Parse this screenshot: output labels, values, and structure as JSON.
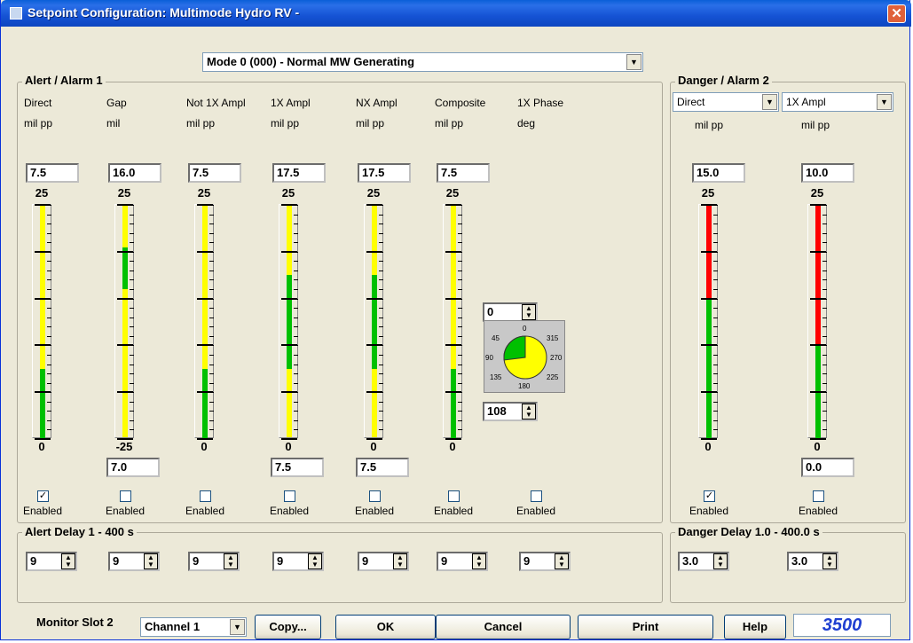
{
  "window": {
    "title": "Setpoint Configuration:  Multimode Hydro RV -",
    "close": "✕"
  },
  "mode_select": {
    "value": "Mode 0 (000) - Normal MW Generating"
  },
  "alert_group": {
    "label": "Alert / Alarm 1"
  },
  "danger_group": {
    "label": "Danger / Alarm 2",
    "combo1": "Direct",
    "combo2": "1X Ampl",
    "unit1": "mil pp",
    "unit2": "mil pp"
  },
  "columns": [
    {
      "name": "Direct",
      "unit": "mil pp",
      "value": "7.5",
      "top": "25",
      "bottom": "0",
      "low": "",
      "enabled": true,
      "enabled_label": "Enabled",
      "delay": "9"
    },
    {
      "name": "Gap",
      "unit": "mil",
      "value": "16.0",
      "top": "25",
      "bottom": "-25",
      "low": "7.0",
      "enabled": false,
      "enabled_label": "Enabled",
      "delay": "9"
    },
    {
      "name": "Not 1X Ampl",
      "unit": "mil pp",
      "value": "7.5",
      "top": "25",
      "bottom": "0",
      "low": "",
      "enabled": false,
      "enabled_label": "Enabled",
      "delay": "9"
    },
    {
      "name": "1X Ampl",
      "unit": "mil pp",
      "value": "17.5",
      "top": "25",
      "bottom": "0",
      "low": "7.5",
      "enabled": false,
      "enabled_label": "Enabled",
      "delay": "9"
    },
    {
      "name": "NX Ampl",
      "unit": "mil pp",
      "value": "17.5",
      "top": "25",
      "bottom": "0",
      "low": "7.5",
      "enabled": false,
      "enabled_label": "Enabled",
      "delay": "9"
    },
    {
      "name": "Composite",
      "unit": "mil pp",
      "value": "7.5",
      "top": "25",
      "bottom": "0",
      "low": "",
      "enabled": false,
      "enabled_label": "Enabled",
      "delay": "9"
    },
    {
      "name": "1X Phase",
      "unit": "deg",
      "enabled": false,
      "enabled_label": "Enabled",
      "delay": "9"
    }
  ],
  "danger_columns": [
    {
      "value": "15.0",
      "top": "25",
      "bottom": "0",
      "low": "",
      "enabled": true,
      "enabled_label": "Enabled",
      "delay": "3.0"
    },
    {
      "value": "10.0",
      "top": "25",
      "bottom": "0",
      "low": "0.0",
      "enabled": false,
      "enabled_label": "Enabled",
      "delay": "3.0"
    }
  ],
  "phase": {
    "upper": "0",
    "lower": "108",
    "ticks": [
      "0",
      "45",
      "315",
      "90",
      "270",
      "135",
      "225",
      "180"
    ]
  },
  "alert_delay": {
    "label": "Alert Delay  1 - 400 s"
  },
  "danger_delay": {
    "label": "Danger Delay  1.0 - 400.0 s"
  },
  "footer": {
    "slot_label": "Monitor Slot 2",
    "channel": "Channel 1",
    "copy": "Copy...",
    "ok": "OK",
    "cancel": "Cancel",
    "print": "Print",
    "help": "Help",
    "brand": "3500"
  },
  "colors": {
    "alert": "#ffff00",
    "danger": "#ff0000",
    "ok": "#00c000"
  },
  "bars": {
    "alert": [
      {
        "green_from": 0,
        "green_to": 7.5,
        "min": 0,
        "max": 25
      },
      {
        "green_from": 7.0,
        "green_to": 16.0,
        "min": -25,
        "max": 25
      },
      {
        "green_from": 0,
        "green_to": 7.5,
        "min": 0,
        "max": 25
      },
      {
        "green_from": 7.5,
        "green_to": 17.5,
        "min": 0,
        "max": 25
      },
      {
        "green_from": 7.5,
        "green_to": 17.5,
        "min": 0,
        "max": 25
      },
      {
        "green_from": 0,
        "green_to": 7.5,
        "min": 0,
        "max": 25
      }
    ],
    "danger": [
      {
        "green_from": 0,
        "green_to": 15.0,
        "min": 0,
        "max": 25
      },
      {
        "green_from": 0,
        "green_to": 10.0,
        "min": 0,
        "max": 25
      }
    ]
  }
}
